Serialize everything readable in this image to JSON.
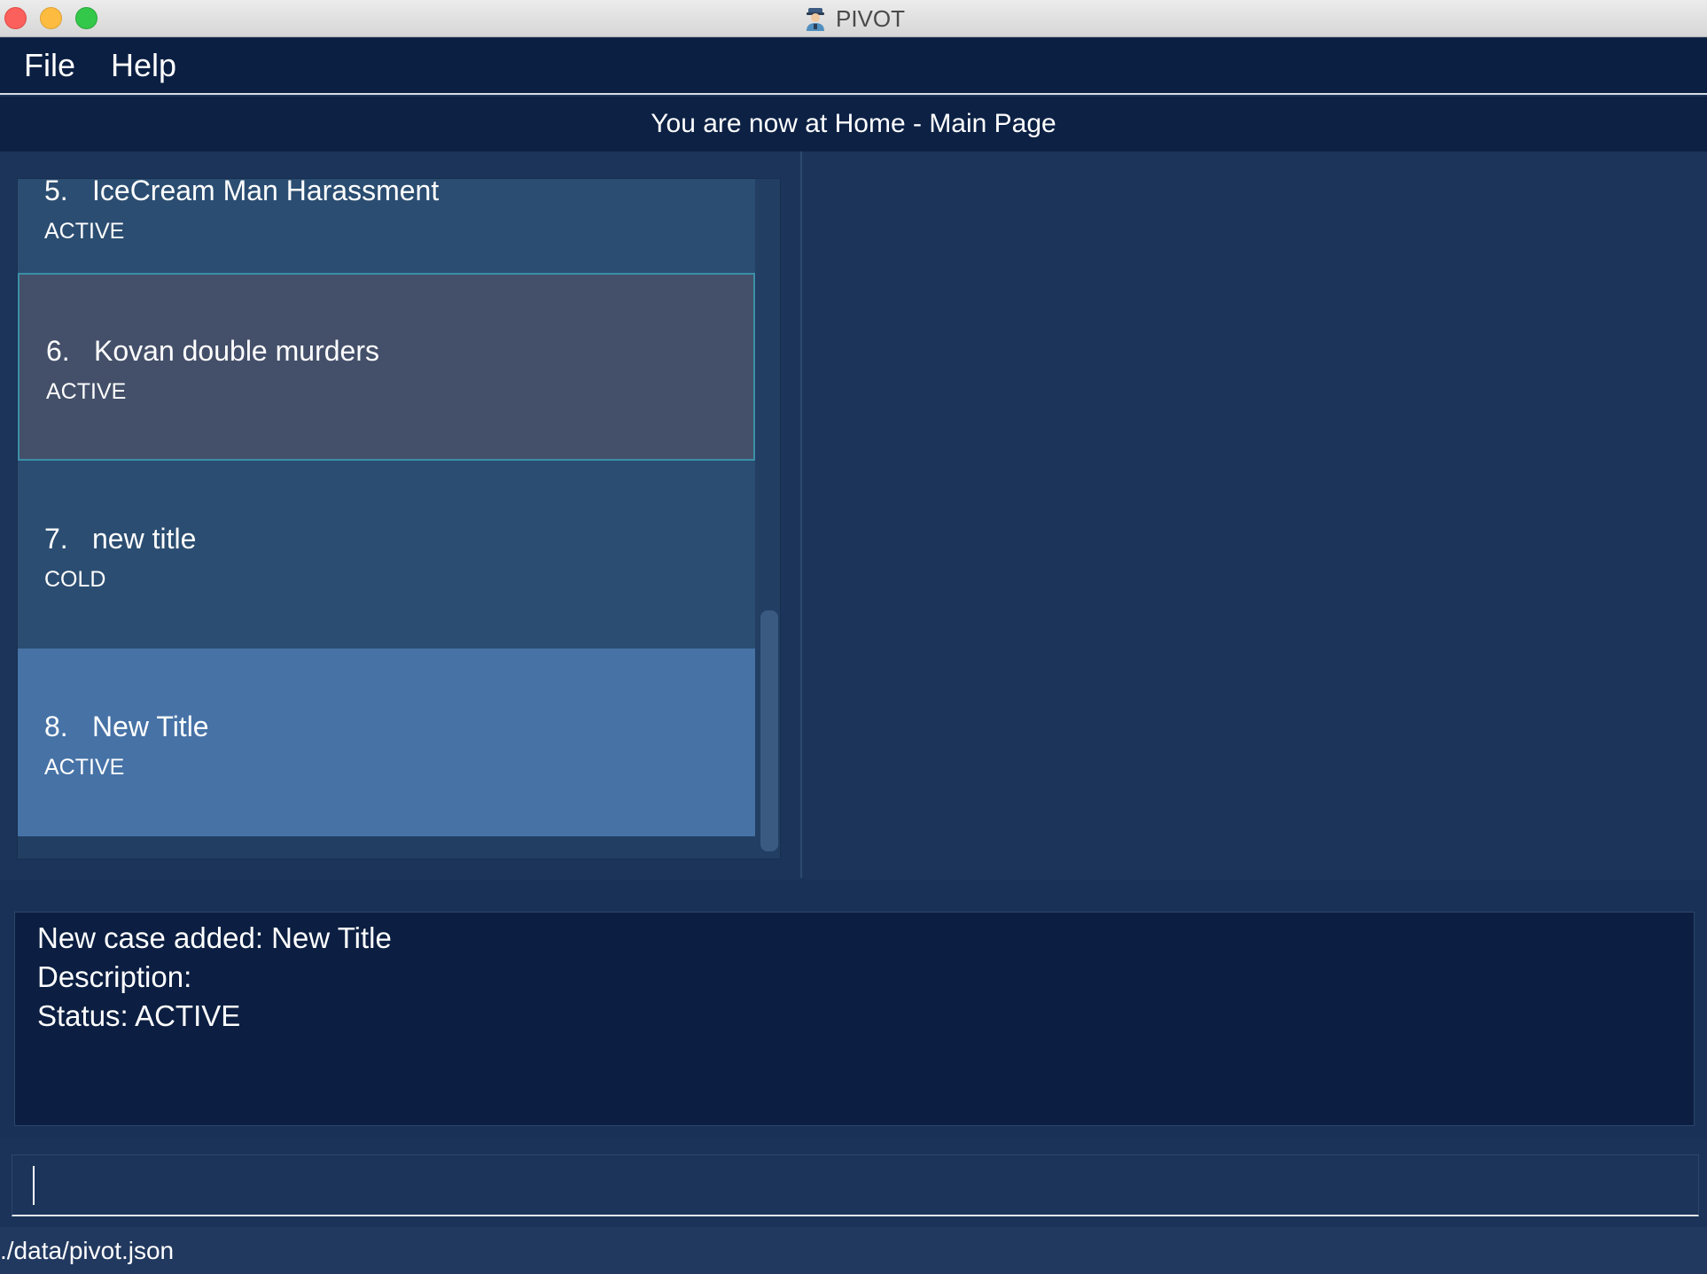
{
  "window": {
    "title": "PIVOT"
  },
  "menu": {
    "file": "File",
    "help": "Help"
  },
  "location": {
    "text": "You are now at Home - Main Page"
  },
  "cases": [
    {
      "number": "5.",
      "title": "IceCream Man Harassment",
      "status": "ACTIVE"
    },
    {
      "number": "6.",
      "title": "Kovan double murders",
      "status": "ACTIVE"
    },
    {
      "number": "7.",
      "title": "new title",
      "status": "COLD"
    },
    {
      "number": "8.",
      "title": "New Title",
      "status": "ACTIVE"
    }
  ],
  "result": {
    "line1": "New case added: New Title",
    "line2": "Description:",
    "line3": "Status: ACTIVE"
  },
  "command": {
    "value": ""
  },
  "statusbar": {
    "path": "./data/pivot.json"
  },
  "colors": {
    "menubar": "#0b1f42",
    "selected_card": "#44506a",
    "highlight_card": "#4672a6",
    "card": "#2b4d71"
  }
}
